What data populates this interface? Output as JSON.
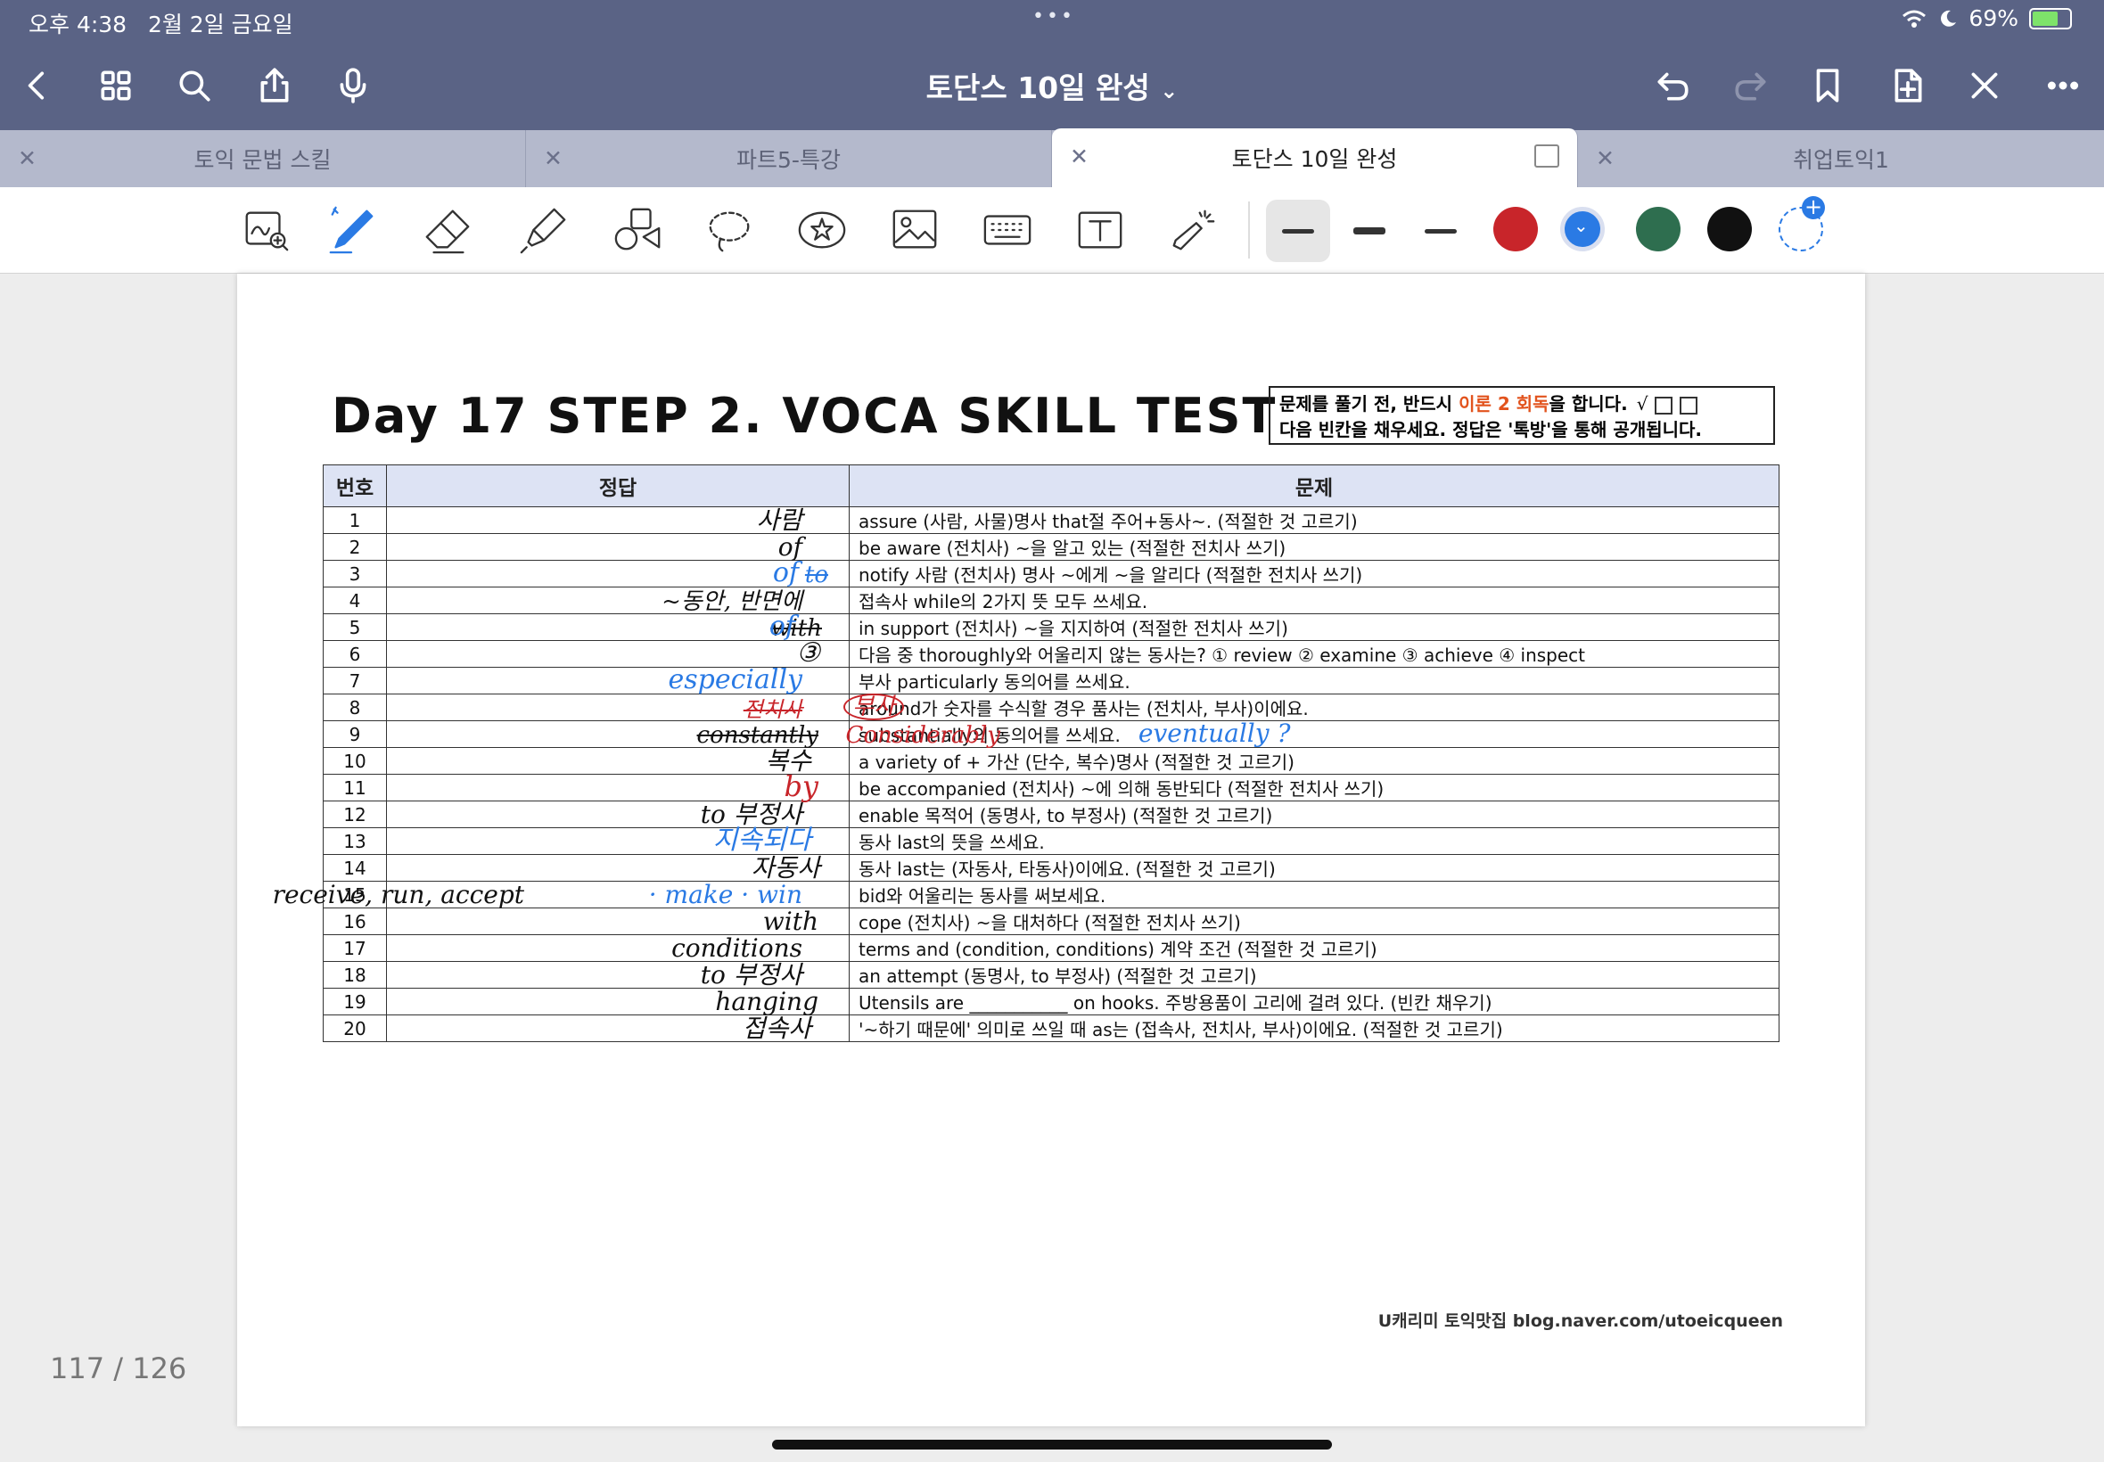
{
  "status": {
    "time": "오후 4:38",
    "date": "2월 2일 금요일",
    "dots": "•••",
    "battery": "69%"
  },
  "toolbar": {
    "doc_title": "토단스 10일 완성",
    "title_chevron": "⌄"
  },
  "tabs": [
    {
      "label": "토익 문법 스킬"
    },
    {
      "label": "파트5-특강"
    },
    {
      "label": "토단스 10일 완성"
    },
    {
      "label": "취업토익1"
    }
  ],
  "tab_close": "✕",
  "pen_colors": {
    "red": "#c8252a",
    "blue": "#2a7ae4",
    "green": "#2e6e4f",
    "black": "#111111"
  },
  "page": {
    "title": "Day 17 STEP 2. VOCA SKILL TEST",
    "notice_line1_a": "문제를 풀기 전, 반드시 ",
    "notice_line1_hl": "이론 2 회독",
    "notice_line1_b": "을 합니다.",
    "notice_check": "√",
    "notice_line2": "다음 빈칸을 채우세요. 정답은 '톡방'을 통해 공개됩니다.",
    "col_num": "번호",
    "col_answer": "정답",
    "col_question": "문제",
    "footer": "U캐리미 토익맛집 blog.naver.com/utoeicqueen"
  },
  "rows": [
    {
      "num": "1",
      "q": "assure (사람, 사물)명사 that절 주어+동사~. (적절한 것 고르기)"
    },
    {
      "num": "2",
      "q": "be aware (전치사) ~을 알고 있는 (적절한 전치사 쓰기)"
    },
    {
      "num": "3",
      "q": "notify 사람 (전치사) 명사 ~에게 ~을 알리다 (적절한 전치사 쓰기)"
    },
    {
      "num": "4",
      "q": "접속사 while의 2가지 뜻 모두 쓰세요."
    },
    {
      "num": "5",
      "q": "in support (전치사) ~을 지지하여 (적절한 전치사 쓰기)"
    },
    {
      "num": "6",
      "q": "다음 중 thoroughly와 어울리지 않는 동사는? ① review ② examine ③ achieve ④ inspect"
    },
    {
      "num": "7",
      "q": "부사 particularly 동의어를 쓰세요."
    },
    {
      "num": "8",
      "q": "around가 숫자를 수식할 경우 품사는 (전치사, 부사)이에요."
    },
    {
      "num": "9",
      "q": "substantially의 동의어를 쓰세요."
    },
    {
      "num": "10",
      "q": "a variety of + 가산 (단수, 복수)명사 (적절한 것 고르기)"
    },
    {
      "num": "11",
      "q": "be accompanied (전치사) ~에 의해 동반되다 (적절한 전치사 쓰기)"
    },
    {
      "num": "12",
      "q": "enable 목적어 (동명사, to 부정사) (적절한 것 고르기)"
    },
    {
      "num": "13",
      "q": "동사 last의 뜻을 쓰세요."
    },
    {
      "num": "14",
      "q": "동사 last는 (자동사, 타동사)이에요. (적절한 것 고르기)"
    },
    {
      "num": "15",
      "q": "bid와 어울리는 동사를 써보세요."
    },
    {
      "num": "16",
      "q": "cope (전치사) ~을 대처하다 (적절한 전치사 쓰기)"
    },
    {
      "num": "17",
      "q": "terms and (condition, conditions) 계약 조건 (적절한 것 고르기)"
    },
    {
      "num": "18",
      "q": "an attempt (동명사, to 부정사) (적절한 것 고르기)"
    },
    {
      "num": "19",
      "q": "Utensils are ___________ on hooks. 주방용품이 고리에 걸려 있다. (빈칸 채우기)"
    },
    {
      "num": "20",
      "q": "'~하기 때문에' 의미로 쓰일 때 as는 (접속사, 전치사, 부사)이에요. (적절한 것 고르기)"
    }
  ],
  "handwriting": {
    "a1": "사람",
    "a2": "of",
    "a3_struck": "to",
    "a3": "of",
    "a4": "~동안, 반면에",
    "a5_struck": "with",
    "a5": "of",
    "a6": "③",
    "a7": "especially",
    "a8_circled": "부사",
    "a8_struck": "전치사",
    "a9_red": "Considerably",
    "a9_struck": "constantly",
    "a9_extra": "eventually ?",
    "a10": "복수",
    "a11": "by",
    "a12": "to 부정사",
    "a13": "지속되다",
    "a14": "자동사",
    "a15": "receive, run, accept",
    "a15_blue": "· make · win",
    "a16": "with",
    "a17": "conditions",
    "a18": "to 부정사",
    "a19": "hanging",
    "a20": "접속사"
  },
  "page_counter": "117 / 126"
}
